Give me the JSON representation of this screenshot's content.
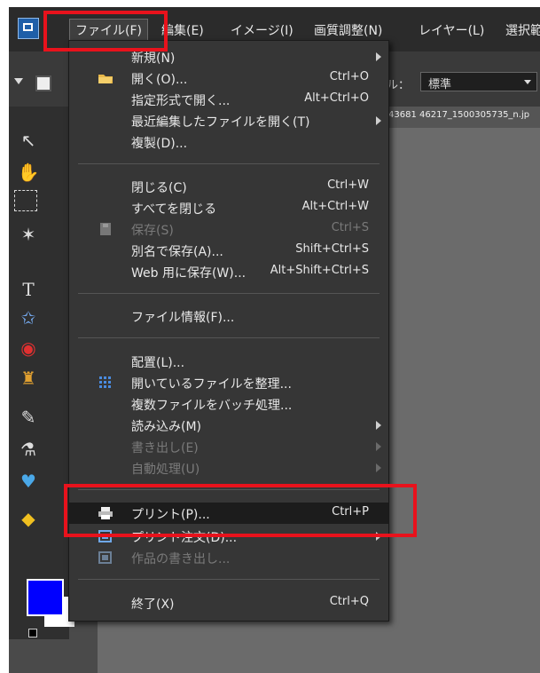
{
  "menubar": {
    "items": [
      "ファイル(F)",
      "編集(E)",
      "イメージ(I)",
      "画質調整(N)",
      "レイヤー(L)",
      "選択範"
    ]
  },
  "options": {
    "label": "ル：",
    "select_value": "標準"
  },
  "document_tab": "43681 46217_1500305735_n.jp",
  "file_menu": {
    "items": [
      {
        "label": "新規(N)",
        "shortcut": "",
        "submenu": true,
        "disabled": false
      },
      {
        "label": "開く(O)...",
        "shortcut": "Ctrl+O",
        "submenu": false,
        "disabled": false,
        "icon": "folder-icon"
      },
      {
        "label": "指定形式で開く...",
        "shortcut": "Alt+Ctrl+O",
        "submenu": false,
        "disabled": false
      },
      {
        "label": "最近編集したファイルを開く(T)",
        "shortcut": "",
        "submenu": true,
        "disabled": false
      },
      {
        "label": "複製(D)...",
        "shortcut": "",
        "submenu": false,
        "disabled": false
      },
      {
        "label": "閉じる(C)",
        "shortcut": "Ctrl+W",
        "submenu": false,
        "disabled": false
      },
      {
        "label": "すべてを閉じる",
        "shortcut": "Alt+Ctrl+W",
        "submenu": false,
        "disabled": false
      },
      {
        "label": "保存(S)",
        "shortcut": "Ctrl+S",
        "submenu": false,
        "disabled": true,
        "icon": "save-icon"
      },
      {
        "label": "別名で保存(A)...",
        "shortcut": "Shift+Ctrl+S",
        "submenu": false,
        "disabled": false
      },
      {
        "label": "Web 用に保存(W)...",
        "shortcut": "Alt+Shift+Ctrl+S",
        "submenu": false,
        "disabled": false
      },
      {
        "label": "ファイル情報(F)...",
        "shortcut": "",
        "submenu": false,
        "disabled": false
      },
      {
        "label": "配置(L)...",
        "shortcut": "",
        "submenu": false,
        "disabled": false
      },
      {
        "label": "開いているファイルを整理...",
        "shortcut": "",
        "submenu": false,
        "disabled": false,
        "icon": "grid-icon"
      },
      {
        "label": "複数ファイルをバッチ処理...",
        "shortcut": "",
        "submenu": false,
        "disabled": false
      },
      {
        "label": "読み込み(M)",
        "shortcut": "",
        "submenu": true,
        "disabled": false
      },
      {
        "label": "書き出し(E)",
        "shortcut": "",
        "submenu": true,
        "disabled": true
      },
      {
        "label": "自動処理(U)",
        "shortcut": "",
        "submenu": true,
        "disabled": true
      },
      {
        "label": "プリント(P)...",
        "shortcut": "Ctrl+P",
        "submenu": false,
        "disabled": false,
        "highlighted": true,
        "icon": "printer-icon"
      },
      {
        "label": "プリント注文(D)...",
        "shortcut": "",
        "submenu": true,
        "disabled": false,
        "icon": "print-order-icon"
      },
      {
        "label": "作品の書き出し...",
        "shortcut": "",
        "submenu": false,
        "disabled": true,
        "icon": "creation-icon"
      },
      {
        "label": "終了(X)",
        "shortcut": "Ctrl+Q",
        "submenu": false,
        "disabled": false
      }
    ]
  },
  "colors": {
    "foreground": "#0000ff",
    "background": "#ffffff",
    "annotation": "#e8121c"
  }
}
